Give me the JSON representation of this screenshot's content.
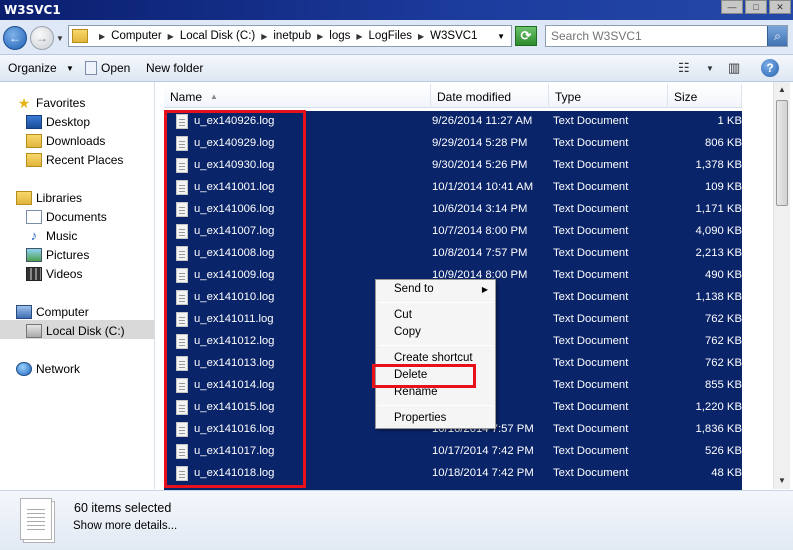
{
  "window": {
    "title": "W3SVC1"
  },
  "address": {
    "breadcrumbs": [
      "Computer",
      "Local Disk (C:)",
      "inetpub",
      "logs",
      "LogFiles",
      "W3SVC1"
    ],
    "search_placeholder": "Search W3SVC1"
  },
  "toolbar": {
    "organize": "Organize",
    "open": "Open",
    "new_folder": "New folder"
  },
  "nav": {
    "favorites": "Favorites",
    "desktop": "Desktop",
    "downloads": "Downloads",
    "recent_places": "Recent Places",
    "libraries": "Libraries",
    "documents": "Documents",
    "music": "Music",
    "pictures": "Pictures",
    "videos": "Videos",
    "computer": "Computer",
    "local_disk": "Local Disk (C:)",
    "network": "Network"
  },
  "columns": {
    "name": "Name",
    "date": "Date modified",
    "type": "Type",
    "size": "Size"
  },
  "files": [
    {
      "name": "u_ex140926.log",
      "date": "9/26/2014 11:27 AM",
      "type": "Text Document",
      "size": "1 KB"
    },
    {
      "name": "u_ex140929.log",
      "date": "9/29/2014 5:28 PM",
      "type": "Text Document",
      "size": "806 KB"
    },
    {
      "name": "u_ex140930.log",
      "date": "9/30/2014 5:26 PM",
      "type": "Text Document",
      "size": "1,378 KB"
    },
    {
      "name": "u_ex141001.log",
      "date": "10/1/2014 10:41 AM",
      "type": "Text Document",
      "size": "109 KB"
    },
    {
      "name": "u_ex141006.log",
      "date": "10/6/2014 3:14 PM",
      "type": "Text Document",
      "size": "1,171 KB"
    },
    {
      "name": "u_ex141007.log",
      "date": "10/7/2014 8:00 PM",
      "type": "Text Document",
      "size": "4,090 KB"
    },
    {
      "name": "u_ex141008.log",
      "date": "10/8/2014 7:57 PM",
      "type": "Text Document",
      "size": "2,213 KB"
    },
    {
      "name": "u_ex141009.log",
      "date": "10/9/2014 8:00 PM",
      "type": "Text Document",
      "size": "490 KB"
    },
    {
      "name": "u_ex141010.log",
      "date": "8:00 PM",
      "type": "Text Document",
      "size": "1,138 KB"
    },
    {
      "name": "u_ex141011.log",
      "date": "8:00 PM",
      "type": "Text Document",
      "size": "762 KB"
    },
    {
      "name": "u_ex141012.log",
      "date": "8:00 PM",
      "type": "Text Document",
      "size": "762 KB"
    },
    {
      "name": "u_ex141013.log",
      "date": "8:00 PM",
      "type": "Text Document",
      "size": "762 KB"
    },
    {
      "name": "u_ex141014.log",
      "date": "8:00 PM",
      "type": "Text Document",
      "size": "855 KB"
    },
    {
      "name": "u_ex141015.log",
      "date": "8:00 PM",
      "type": "Text Document",
      "size": "1,220 KB"
    },
    {
      "name": "u_ex141016.log",
      "date": "10/16/2014 7:57 PM",
      "type": "Text Document",
      "size": "1,836 KB"
    },
    {
      "name": "u_ex141017.log",
      "date": "10/17/2014 7:42 PM",
      "type": "Text Document",
      "size": "526 KB"
    },
    {
      "name": "u_ex141018.log",
      "date": "10/18/2014 7:42 PM",
      "type": "Text Document",
      "size": "48 KB"
    }
  ],
  "context_menu": {
    "send_to": "Send to",
    "cut": "Cut",
    "copy": "Copy",
    "create_shortcut": "Create shortcut",
    "delete": "Delete",
    "rename": "Rename",
    "properties": "Properties"
  },
  "details": {
    "count": "60 items selected",
    "more": "Show more details..."
  },
  "icons": {
    "back": "back-arrow-icon",
    "forward": "forward-arrow-icon",
    "refresh": "refresh-icon",
    "search": "search-icon",
    "help": "help-icon",
    "file": "text-file-icon"
  },
  "colors": {
    "selection": "#0a246a",
    "highlight_box": "#e8101a",
    "title_bar": "#0a1e6e"
  }
}
